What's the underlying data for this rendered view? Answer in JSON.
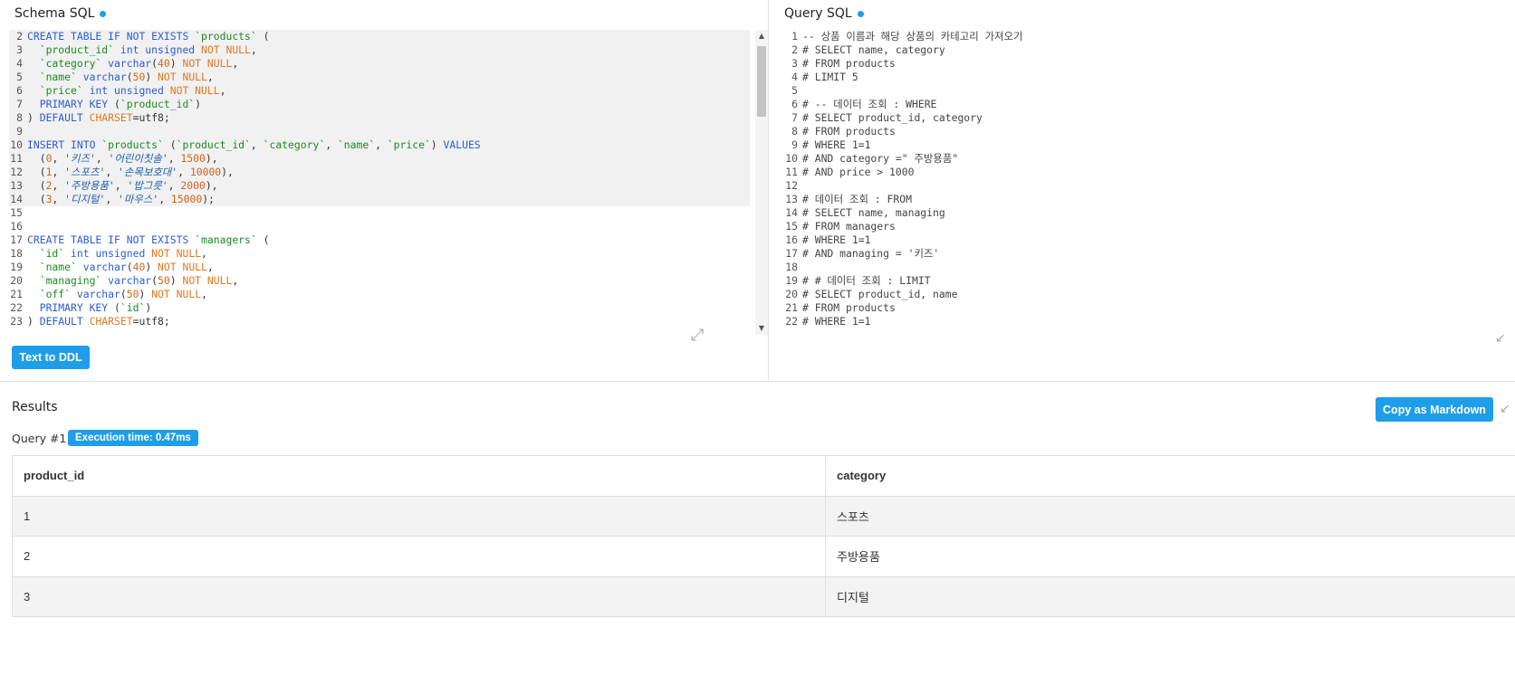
{
  "schema_panel": {
    "title": "Schema SQL",
    "button_label": "Text to DDL"
  },
  "query_panel": {
    "title": "Query SQL"
  },
  "schema_lines": [
    {
      "n": "2",
      "hl": true,
      "t": [
        [
          "kw",
          "CREATE TABLE IF NOT EXISTS "
        ],
        [
          "str",
          "`products`"
        ],
        [
          "pl",
          " ("
        ]
      ]
    },
    {
      "n": "3",
      "hl": true,
      "t": [
        [
          "str",
          "  `product_id`"
        ],
        [
          "kw",
          " int unsigned "
        ],
        [
          "nul",
          "NOT NULL"
        ],
        [
          "pl",
          ","
        ]
      ]
    },
    {
      "n": "4",
      "hl": true,
      "t": [
        [
          "str",
          "  `category`"
        ],
        [
          "kw",
          " varchar"
        ],
        [
          "pl",
          "("
        ],
        [
          "num",
          "40"
        ],
        [
          "pl",
          ") "
        ],
        [
          "nul",
          "NOT NULL"
        ],
        [
          "pl",
          ","
        ]
      ]
    },
    {
      "n": "5",
      "hl": true,
      "t": [
        [
          "str",
          "  `name`"
        ],
        [
          "kw",
          " varchar"
        ],
        [
          "pl",
          "("
        ],
        [
          "num",
          "50"
        ],
        [
          "pl",
          ") "
        ],
        [
          "nul",
          "NOT NULL"
        ],
        [
          "pl",
          ","
        ]
      ]
    },
    {
      "n": "6",
      "hl": true,
      "t": [
        [
          "str",
          "  `price`"
        ],
        [
          "kw",
          " int unsigned "
        ],
        [
          "nul",
          "NOT NULL"
        ],
        [
          "pl",
          ","
        ]
      ]
    },
    {
      "n": "7",
      "hl": true,
      "t": [
        [
          "kw",
          "  PRIMARY KEY "
        ],
        [
          "pl",
          "("
        ],
        [
          "str",
          "`product_id`"
        ],
        [
          "pl",
          ")"
        ]
      ]
    },
    {
      "n": "8",
      "hl": true,
      "t": [
        [
          "pl",
          ") "
        ],
        [
          "kw",
          "DEFAULT "
        ],
        [
          "nul",
          "CHARSET"
        ],
        [
          "pl",
          "=utf8;"
        ]
      ]
    },
    {
      "n": "9",
      "hl": true,
      "t": []
    },
    {
      "n": "10",
      "hl": true,
      "t": [
        [
          "kw",
          "INSERT INTO "
        ],
        [
          "str",
          "`products`"
        ],
        [
          "pl",
          " ("
        ],
        [
          "str",
          "`product_id`"
        ],
        [
          "pl",
          ", "
        ],
        [
          "str",
          "`category`"
        ],
        [
          "pl",
          ", "
        ],
        [
          "str",
          "`name`"
        ],
        [
          "pl",
          ", "
        ],
        [
          "str",
          "`price`"
        ],
        [
          "pl",
          ") "
        ],
        [
          "kw",
          "VALUES"
        ]
      ]
    },
    {
      "n": "11",
      "hl": true,
      "t": [
        [
          "pl",
          "  ("
        ],
        [
          "num",
          "0"
        ],
        [
          "pl",
          ", "
        ],
        [
          "kstr",
          "'키즈'"
        ],
        [
          "pl",
          ", "
        ],
        [
          "kstr",
          "'어린이칫솔'"
        ],
        [
          "pl",
          ", "
        ],
        [
          "num",
          "1500"
        ],
        [
          "pl",
          "),"
        ]
      ]
    },
    {
      "n": "12",
      "hl": true,
      "t": [
        [
          "pl",
          "  ("
        ],
        [
          "num",
          "1"
        ],
        [
          "pl",
          ", "
        ],
        [
          "kstr",
          "'스포츠'"
        ],
        [
          "pl",
          ", "
        ],
        [
          "kstr",
          "'손목보호대'"
        ],
        [
          "pl",
          ", "
        ],
        [
          "num",
          "10000"
        ],
        [
          "pl",
          "),"
        ]
      ]
    },
    {
      "n": "13",
      "hl": true,
      "t": [
        [
          "pl",
          "  ("
        ],
        [
          "num",
          "2"
        ],
        [
          "pl",
          ", "
        ],
        [
          "kstr",
          "'주방용품'"
        ],
        [
          "pl",
          ", "
        ],
        [
          "kstr",
          "'밥그릇'"
        ],
        [
          "pl",
          ", "
        ],
        [
          "num",
          "2000"
        ],
        [
          "pl",
          "),"
        ]
      ]
    },
    {
      "n": "14",
      "hl": true,
      "t": [
        [
          "pl",
          "  ("
        ],
        [
          "num",
          "3"
        ],
        [
          "pl",
          ", "
        ],
        [
          "kstr",
          "'디지털'"
        ],
        [
          "pl",
          ", "
        ],
        [
          "kstr",
          "'마우스'"
        ],
        [
          "pl",
          ", "
        ],
        [
          "num",
          "15000"
        ],
        [
          "pl",
          ");"
        ]
      ]
    },
    {
      "n": "15",
      "hl": false,
      "t": []
    },
    {
      "n": "16",
      "hl": false,
      "t": []
    },
    {
      "n": "17",
      "hl": false,
      "t": [
        [
          "kw",
          "CREATE TABLE IF NOT EXISTS "
        ],
        [
          "str",
          "`managers`"
        ],
        [
          "pl",
          " ("
        ]
      ]
    },
    {
      "n": "18",
      "hl": false,
      "t": [
        [
          "str",
          "  `id`"
        ],
        [
          "kw",
          " int unsigned "
        ],
        [
          "nul",
          "NOT NULL"
        ],
        [
          "pl",
          ","
        ]
      ]
    },
    {
      "n": "19",
      "hl": false,
      "t": [
        [
          "str",
          "  `name`"
        ],
        [
          "kw",
          " varchar"
        ],
        [
          "pl",
          "("
        ],
        [
          "num",
          "40"
        ],
        [
          "pl",
          ") "
        ],
        [
          "nul",
          "NOT NULL"
        ],
        [
          "pl",
          ","
        ]
      ]
    },
    {
      "n": "20",
      "hl": false,
      "t": [
        [
          "str",
          "  `managing`"
        ],
        [
          "kw",
          " varchar"
        ],
        [
          "pl",
          "("
        ],
        [
          "num",
          "50"
        ],
        [
          "pl",
          ") "
        ],
        [
          "nul",
          "NOT NULL"
        ],
        [
          "pl",
          ","
        ]
      ]
    },
    {
      "n": "21",
      "hl": false,
      "t": [
        [
          "str",
          "  `off`"
        ],
        [
          "kw",
          " varchar"
        ],
        [
          "pl",
          "("
        ],
        [
          "num",
          "50"
        ],
        [
          "pl",
          ") "
        ],
        [
          "nul",
          "NOT NULL"
        ],
        [
          "pl",
          ","
        ]
      ]
    },
    {
      "n": "22",
      "hl": false,
      "t": [
        [
          "kw",
          "  PRIMARY KEY "
        ],
        [
          "pl",
          "("
        ],
        [
          "str",
          "`id`"
        ],
        [
          "pl",
          ")"
        ]
      ]
    },
    {
      "n": "23",
      "hl": false,
      "t": [
        [
          "pl",
          ") "
        ],
        [
          "kw",
          "DEFAULT "
        ],
        [
          "nul",
          "CHARSET"
        ],
        [
          "pl",
          "=utf8;"
        ]
      ]
    }
  ],
  "query_lines": [
    {
      "n": "1",
      "t": "-- 상품 이름과 해당 상품의 카테고리 가져오기"
    },
    {
      "n": "2",
      "t": "# SELECT name, category"
    },
    {
      "n": "3",
      "t": "# FROM products"
    },
    {
      "n": "4",
      "t": "# LIMIT 5"
    },
    {
      "n": "5",
      "t": ""
    },
    {
      "n": "6",
      "t": "# -- 데이터 조회 : WHERE"
    },
    {
      "n": "7",
      "t": "# SELECT product_id, category"
    },
    {
      "n": "8",
      "t": "# FROM products"
    },
    {
      "n": "9",
      "t": "# WHERE 1=1"
    },
    {
      "n": "10",
      "t": "# AND category =\" 주방용품\""
    },
    {
      "n": "11",
      "t": "# AND price > 1000"
    },
    {
      "n": "12",
      "t": ""
    },
    {
      "n": "13",
      "t": "# 데이터 조회 : FROM"
    },
    {
      "n": "14",
      "t": "# SELECT name, managing"
    },
    {
      "n": "15",
      "t": "# FROM managers"
    },
    {
      "n": "16",
      "t": "# WHERE 1=1"
    },
    {
      "n": "17",
      "t": "# AND managing = '키즈'"
    },
    {
      "n": "18",
      "t": ""
    },
    {
      "n": "19",
      "t": "# # 데이터 조회 : LIMIT"
    },
    {
      "n": "20",
      "t": "# SELECT product_id, name"
    },
    {
      "n": "21",
      "t": "# FROM products"
    },
    {
      "n": "22",
      "t": "# WHERE 1=1"
    }
  ],
  "results": {
    "title": "Results",
    "copy_label": "Copy as Markdown",
    "query_label": "Query #1",
    "execution_time": "Execution time: 0.47ms",
    "columns": [
      "product_id",
      "category"
    ],
    "rows": [
      [
        "1",
        "스포츠"
      ],
      [
        "2",
        "주방용품"
      ],
      [
        "3",
        "디지털"
      ]
    ]
  },
  "colors": {
    "accent": "#1e9ee8",
    "keyword": "#2a5bd6",
    "string": "#1b8a22",
    "number": "#d06418"
  }
}
